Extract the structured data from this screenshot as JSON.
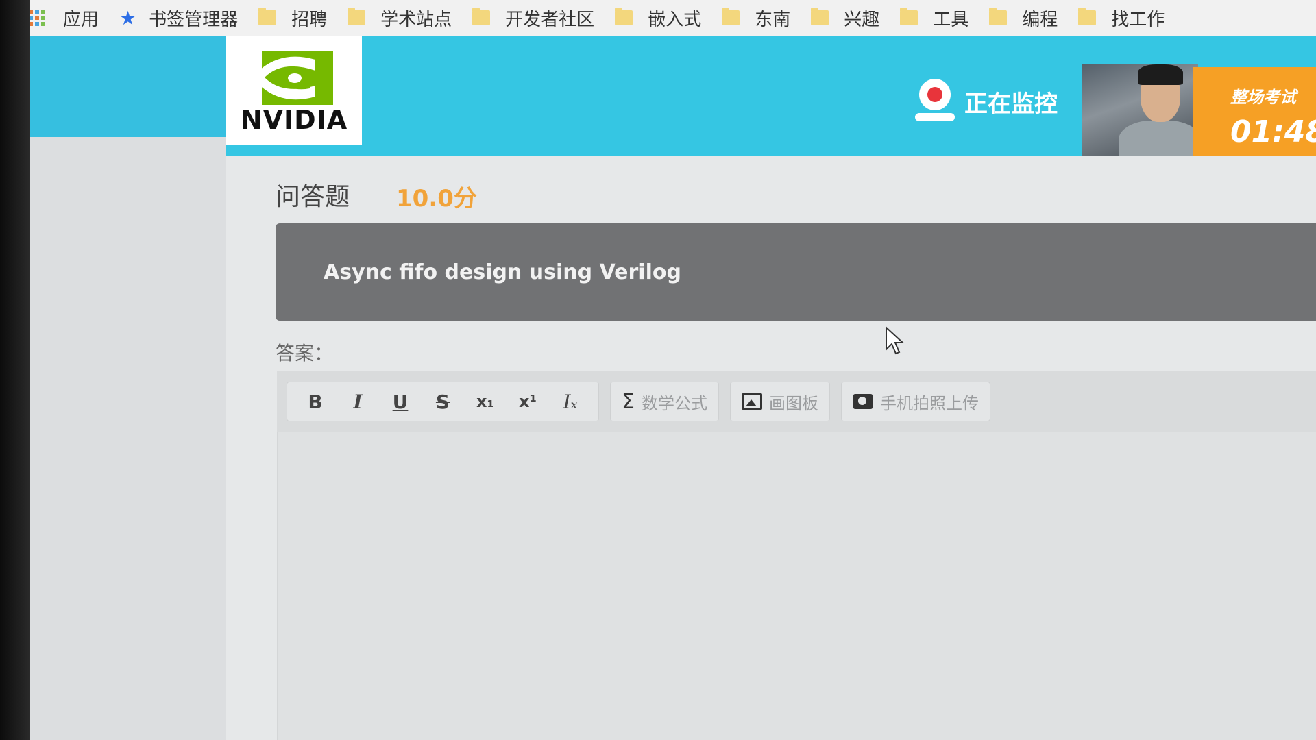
{
  "bookmarks": {
    "apps": "应用",
    "manager": "书签管理器",
    "folders": [
      "招聘",
      "学术站点",
      "开发者社区",
      "嵌入式",
      "东南",
      "兴趣",
      "工具",
      "编程",
      "找工作"
    ]
  },
  "header": {
    "brand": "NVIDIA",
    "monitor_status": "正在监控",
    "timer_label": "整场考试",
    "timer_value": "01:48"
  },
  "question": {
    "type": "问答题",
    "score": "10.0分",
    "text": "Async fifo design using Verilog"
  },
  "answer": {
    "label": "答案："
  },
  "toolbar": {
    "bold": "B",
    "italic": "I",
    "underline": "U",
    "strike": "S",
    "subscript": "x₁",
    "superscript": "x¹",
    "clear_format": "Iₓ",
    "formula": "数学公式",
    "drawing": "画图板",
    "phone_upload": "手机拍照上传"
  },
  "colors": {
    "header_cyan": "#35c6e3",
    "score_orange": "#f1a33a",
    "timer_orange": "#f6a025",
    "question_bar": "#717274",
    "nvidia_green": "#76b900"
  }
}
